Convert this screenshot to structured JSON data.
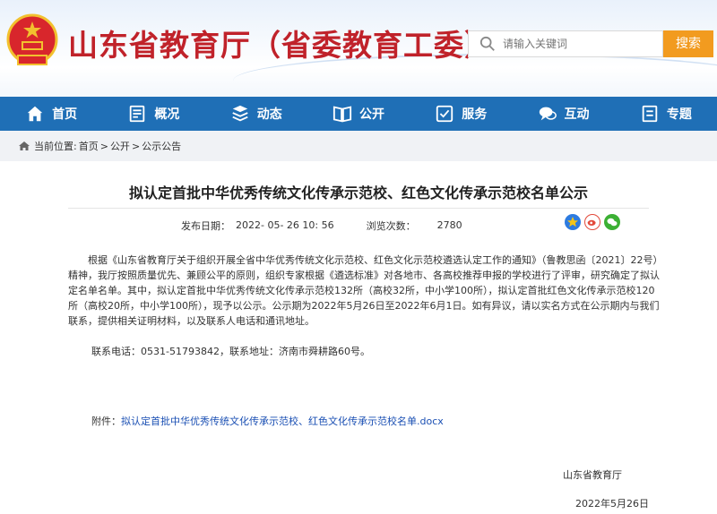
{
  "header": {
    "site_title": "山东省教育厅（省委教育工委）",
    "search_placeholder": "请输入关键词",
    "search_button": "搜索"
  },
  "nav": {
    "items": [
      {
        "label": "首页",
        "icon": "home-icon"
      },
      {
        "label": "概况",
        "icon": "overview-icon"
      },
      {
        "label": "动态",
        "icon": "news-icon"
      },
      {
        "label": "公开",
        "icon": "book-icon"
      },
      {
        "label": "服务",
        "icon": "service-icon"
      },
      {
        "label": "互动",
        "icon": "chat-icon"
      },
      {
        "label": "专题",
        "icon": "topic-icon"
      }
    ]
  },
  "breadcrumb": {
    "prefix": "当前位置:",
    "items": [
      "首页",
      "公开",
      "公示公告"
    ],
    "separator": ">"
  },
  "article": {
    "title": "拟认定首批中华优秀传统文化传承示范校、红色文化传承示范校名单公示",
    "date_label": "发布日期：",
    "date": "2022- 05- 26 10: 56",
    "views_label": "浏览次数：",
    "views": "2780",
    "paragraph": "根据《山东省教育厅关于组织开展全省中华优秀传统文化示范校、红色文化示范校遴选认定工作的通知》（鲁教思函〔2021〕22号）精神，我厅按照质量优先、兼顾公平的原则，组织专家根据《遴选标准》对各地市、各高校推荐申报的学校进行了评审，研究确定了拟认定名单名单。其中，拟认定首批中华优秀传统文化传承示范校132所（高校32所，中小学100所），拟认定首批红色文化传承示范校120所（高校20所，中小学100所），现予以公示。公示期为2022年5月26日至2022年6月1日。如有异议，请以实名方式在公示期内与我们联系，提供相关证明材料，以及联系人电话和通讯地址。",
    "contact": "联系电话：0531-51793842，联系地址：济南市舜耕路60号。",
    "attachment_label": "附件：",
    "attachment_link": "拟认定首批中华优秀传统文化传承示范校、红色文化传承示范校名单.docx",
    "signature_org": "山东省教育厅",
    "signature_date": "2022年5月26日"
  },
  "share_icons": [
    "qzone-icon",
    "weibo-icon",
    "wechat-icon"
  ],
  "colors": {
    "title_red": "#c0222a",
    "nav_blue": "#1f6fb6",
    "search_orange": "#f29b1f",
    "link_blue": "#1a4fb3"
  }
}
